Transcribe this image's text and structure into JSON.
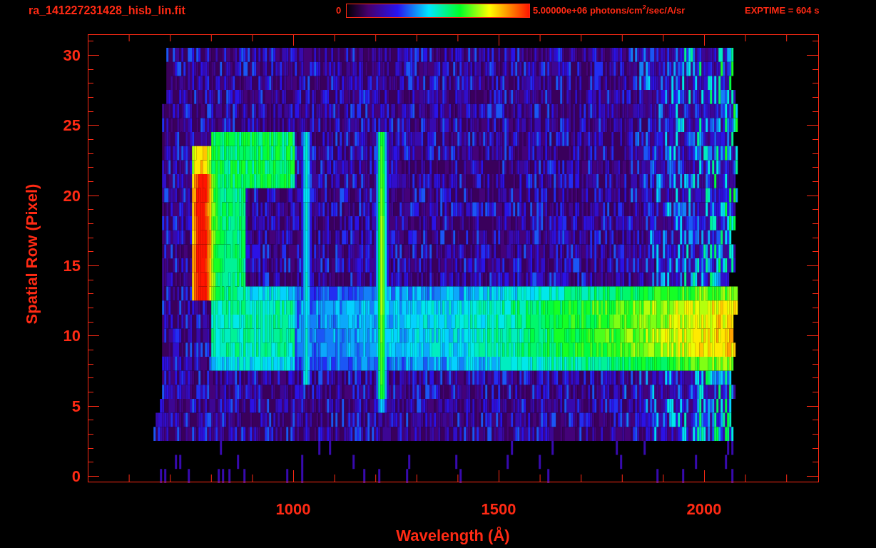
{
  "title": "ra_141227231428_hisb_lin.fit",
  "colorbar": {
    "min_label": "0",
    "max_label": "5.00000e+06 photons/cm$^{2}$/sec/A/sr"
  },
  "exposure": "EXPTIME = 604 s",
  "y_axis": {
    "label": "Spatial Row (Pixel)",
    "ticks": [
      "30",
      "25",
      "20",
      "15",
      "10",
      "5",
      "0"
    ]
  },
  "x_axis": {
    "label": "Wavelength (Å)",
    "ticks": [
      "1000",
      "1500",
      "2000"
    ]
  }
}
